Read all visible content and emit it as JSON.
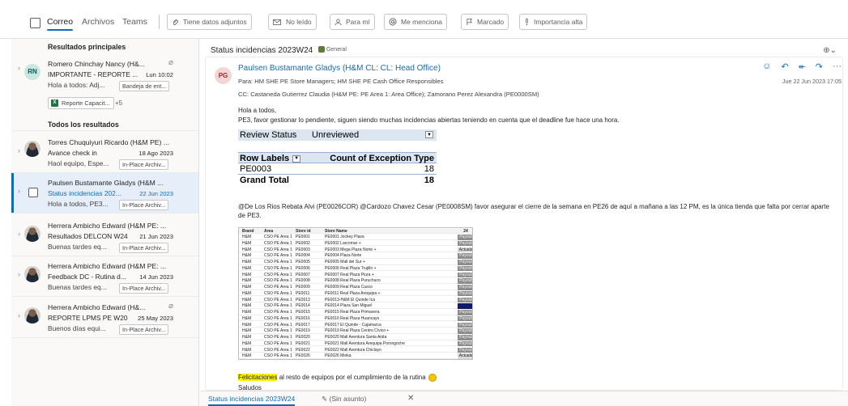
{
  "filter_bar": {
    "tabs": [
      "Correo",
      "Archivos",
      "Teams"
    ],
    "filters": [
      "Tiene datos adjuntos",
      "No leído",
      "Para mí",
      "Me menciona",
      "Marcado",
      "Importancia alta"
    ]
  },
  "list": {
    "top_header": "Resultados principales",
    "all_header": "Todos los resultados",
    "top_item": {
      "initials": "RN",
      "sender": "Romero Chinchay Nancy (H&...",
      "subject": "IMPORTANTE - REPORTE ...",
      "date": "Lun 10:02",
      "preview": "Hola a todos: Adj...",
      "folder": "Bandeja de ent...",
      "attachment": "Reporte Capacit...",
      "more_attachments": "+5"
    },
    "items": [
      {
        "sender": "Torres Chuquiyuri Ricardo (H&M PE) ...",
        "subject": "Avance check in",
        "date": "18 Ago 2023",
        "preview": "Haol equipo, Espe...",
        "folder": "In-Place Archiv..."
      },
      {
        "sender": "Paulsen Bustamante Gladys (H&M ...",
        "subject": "Status incidencias 202...",
        "date": "22 Jun 2023",
        "preview": "Hola a todos, PE3...",
        "folder": "In-Place Archiv..."
      },
      {
        "sender": "Herrera Ambicho Edward (H&M PE: ...",
        "subject": "Resultados DELCON W24",
        "date": "21 Jun 2023",
        "preview": "Buenas tardes eq...",
        "folder": "In-Place Archiv..."
      },
      {
        "sender": "Herrera Ambicho Edward (H&M PE: ...",
        "subject": "Feedback DC - Rutina d...",
        "date": "14 Jun 2023",
        "preview": "Buenas tardes eq...",
        "folder": "In-Place Archiv..."
      },
      {
        "sender": "Herrera Ambicho Edward (H&...",
        "subject": "REPORTE LPMS PE W20",
        "date": "25 May 2023",
        "preview": "Buenos días equi...",
        "folder": "In-Place Archiv..."
      }
    ]
  },
  "reading": {
    "thread_title": "Status incidencias 2023W24",
    "channel_badge": "General",
    "sender_initials": "PG",
    "from": "Paulsen Bustamante Gladys (H&M CL: CL: Head Office)",
    "to": "Para:  HM SHE PE Store Managers;  HM SHE PE Cash Office Responsibles",
    "cc": "CC:  Castaneda Gutierrez Claudia (H&M PE: PE Area 1: Area Office);  Zamorano Perez Alexandra (PE0000SM)",
    "sent_date": "Jue 22 Jun 2023 17:05",
    "greeting": "Hola a todos,",
    "line2": "PE3, favor gestionar lo pendiente, siguen siendo muchas incidencias abiertas teniendo en cuenta que el deadline fue hace una hora.",
    "pivot": {
      "filter_label": "Review Status",
      "filter_value": "Unreviewed",
      "row_labels": "Row Labels",
      "count_header": "Count of Exception Type",
      "data_label": "PE0003",
      "data_value": "18",
      "total_label": "Grand Total",
      "total_value": "18"
    },
    "mention_para": "@De Los Rios Rebata Alvi (PE0026COR) @Cardozo Chavez Cesar (PE0008SM) favor asegurar el cierre de la semana en PE26 de aquí a mañana a las 12 PM, es la única tienda que falta por cerrar aparte de PE3.",
    "sheet_header": [
      "Brand",
      "Area",
      "Store id",
      "Store Name",
      "24"
    ],
    "sheet_rows": [
      [
        "H&M",
        "CSO PE Area 1",
        "PE0001",
        "PE0001 Jockey Plaza",
        "Payout",
        "grey"
      ],
      [
        "H&M",
        "CSO PE Area 1",
        "PE0002",
        "PE0002 Larcomar +",
        "Payout",
        "grey"
      ],
      [
        "H&M",
        "CSO PE Area 1",
        "PE0003",
        "PE0003 Mega Plaza Norte +",
        "Actuals",
        "act"
      ],
      [
        "H&M",
        "CSO PE Area 1",
        "PE0004",
        "PE0004 Plaza Norte",
        "Payout",
        "grey"
      ],
      [
        "H&M",
        "CSO PE Area 1",
        "PE0005",
        "PE0005 Mall del Sur +",
        "Payout",
        "grey"
      ],
      [
        "H&M",
        "CSO PE Area 1",
        "PE0006",
        "PE0006 Real Plaza Trujillo +",
        "Payout",
        "grey"
      ],
      [
        "H&M",
        "CSO PE Area 1",
        "PE0007",
        "PE0007 Real Plaza Piura +",
        "Payout",
        "grey"
      ],
      [
        "H&M",
        "CSO PE Area 1",
        "PE0008",
        "PE0008 Real Plaza Puruchuco",
        "Payout",
        "grey"
      ],
      [
        "H&M",
        "CSO PE Area 1",
        "PE0009",
        "PE0009 Real Plaza Cusco",
        "Payout",
        "grey"
      ],
      [
        "H&M",
        "CSO PE Area 1",
        "PE0011",
        "PE0011 Real Plaza Arequipa +",
        "Payout",
        "grey"
      ],
      [
        "H&M",
        "CSO PE Area 1",
        "PE0013",
        "PE0013-H&M El Quinde Ica",
        "Payout",
        "grey"
      ],
      [
        "H&M",
        "CSO PE Area 1",
        "PE0014",
        "PE0014 Plaza San Miguel",
        "",
        "navy"
      ],
      [
        "H&M",
        "CSO PE Area 1",
        "PE0015",
        "PE0015 Real Plaza Primavera",
        "Payout",
        "grey"
      ],
      [
        "H&M",
        "CSO PE Area 1",
        "PE0016",
        "PE0016 Real Plaza Huancayo",
        "Payout",
        "grey"
      ],
      [
        "H&M",
        "CSO PE Area 1",
        "PE0017",
        "PE0017 El Quinde - Cajamarca",
        "Payout",
        "grey"
      ],
      [
        "H&M",
        "CSO PE Area 1",
        "PE0019",
        "PE0019 Real Plaza Centro Cívico +",
        "Payout",
        "grey"
      ],
      [
        "H&M",
        "CSO PE Area 1",
        "PE0020",
        "PE0020 Mall Aventura Santa Anita",
        "Payout",
        "grey"
      ],
      [
        "H&M",
        "CSO PE Area 1",
        "PE0021",
        "PE0021 Mall Aventura Arequipa Porongoche",
        "Payout",
        "grey"
      ],
      [
        "H&M",
        "CSO PE Area 1",
        "PE0022",
        "PE0022 Mall Aventura Chiclayo",
        "Payout",
        "grey"
      ],
      [
        "H&M",
        "CSO PE Area 1",
        "PE0026",
        "PE0026 Minka",
        "Actuals",
        "act"
      ]
    ],
    "congrats_highlight": "Felicitaciones",
    "congrats_rest": " al resto de equipos por el cumplimiento de la rutina",
    "closing": "Saludos"
  },
  "bottom_tabs": {
    "active": "Status incidencias 2023W24",
    "draft": "(Sin asunto)"
  }
}
